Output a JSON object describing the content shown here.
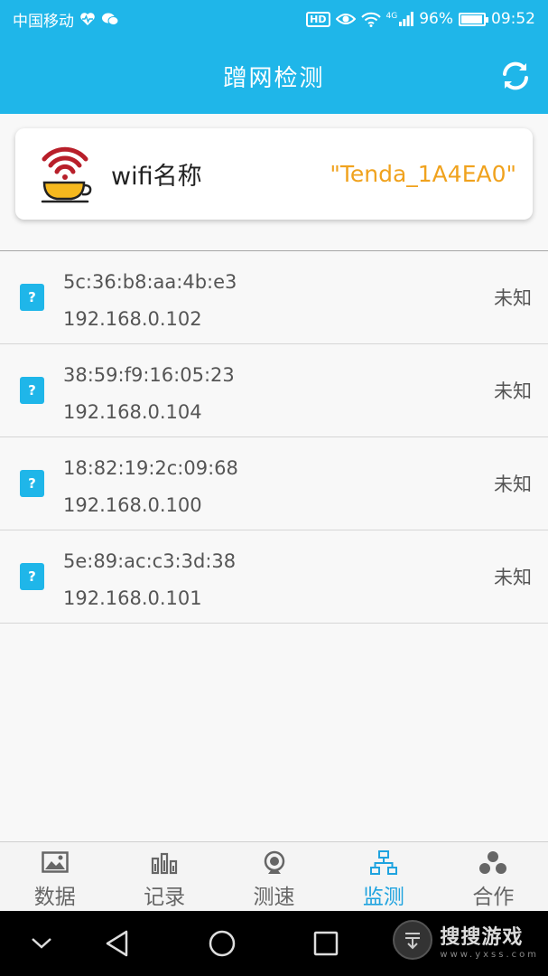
{
  "status_bar": {
    "carrier": "中国移动",
    "hd": "HD",
    "network": "4G",
    "battery": "96%",
    "battery_level": 0.96,
    "time": "09:52"
  },
  "header": {
    "title": "蹭网检测"
  },
  "wifi_card": {
    "label": "wifi名称",
    "ssid": "\"Tenda_1A4EA0\""
  },
  "devices": [
    {
      "mac": "5c:36:b8:aa:4b:e3",
      "ip": "192.168.0.102",
      "status": "未知",
      "icon": "?"
    },
    {
      "mac": "38:59:f9:16:05:23",
      "ip": "192.168.0.104",
      "status": "未知",
      "icon": "?"
    },
    {
      "mac": "18:82:19:2c:09:68",
      "ip": "192.168.0.100",
      "status": "未知",
      "icon": "?"
    },
    {
      "mac": "5e:89:ac:c3:3d:38",
      "ip": "192.168.0.101",
      "status": "未知",
      "icon": "?"
    }
  ],
  "tabs": [
    {
      "label": "数据",
      "icon": "image-icon"
    },
    {
      "label": "记录",
      "icon": "bar-chart-icon"
    },
    {
      "label": "测速",
      "icon": "webcam-icon"
    },
    {
      "label": "监测",
      "icon": "network-icon",
      "active": true
    },
    {
      "label": "合作",
      "icon": "cooperation-icon"
    }
  ],
  "watermark": {
    "main": "搜搜游戏",
    "sub": "www.yxss.com"
  },
  "colors": {
    "accent": "#1fb6e9",
    "ssid": "#f0a21d",
    "active_tab": "#1fa3df"
  }
}
